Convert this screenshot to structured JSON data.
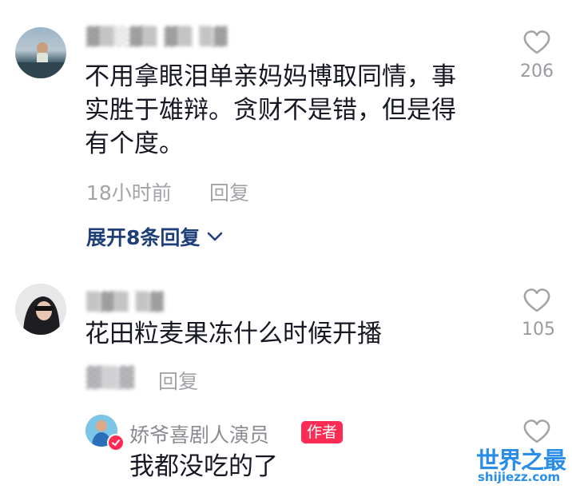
{
  "comments": [
    {
      "username": "▓▒░▓▒ ▓▒ ▒▓",
      "text_line1": "不用拿眼泪单亲妈妈博取同情，事",
      "text_line2": "实胜于雄辩。贪财不是错，但是得",
      "text_line3": "有个度。",
      "time": "18小时前",
      "reply_label": "回复",
      "likes": "206",
      "expand_label": "展开8条回复"
    },
    {
      "username": "▒▓▒ ▒▓",
      "text": "花田粒麦果冻什么时候开播",
      "time": "▓▒▓",
      "reply_label": "回复",
      "likes": "105"
    }
  ],
  "reply": {
    "username": "娇爷喜剧人演员",
    "badge": "作者",
    "text": "我都没吃的了"
  },
  "watermark": {
    "main": "世界之最",
    "sub": "shijiezz.com"
  },
  "icons": {
    "like": "heart-outline-icon",
    "expand": "chevron-down-icon",
    "verified": "verified-badge-icon"
  },
  "colors": {
    "text": "#161823",
    "meta": "#a3a3a8",
    "expand": "#1f3f7a",
    "badge": "#fe2c55",
    "watermark": "#2a8ee8"
  }
}
